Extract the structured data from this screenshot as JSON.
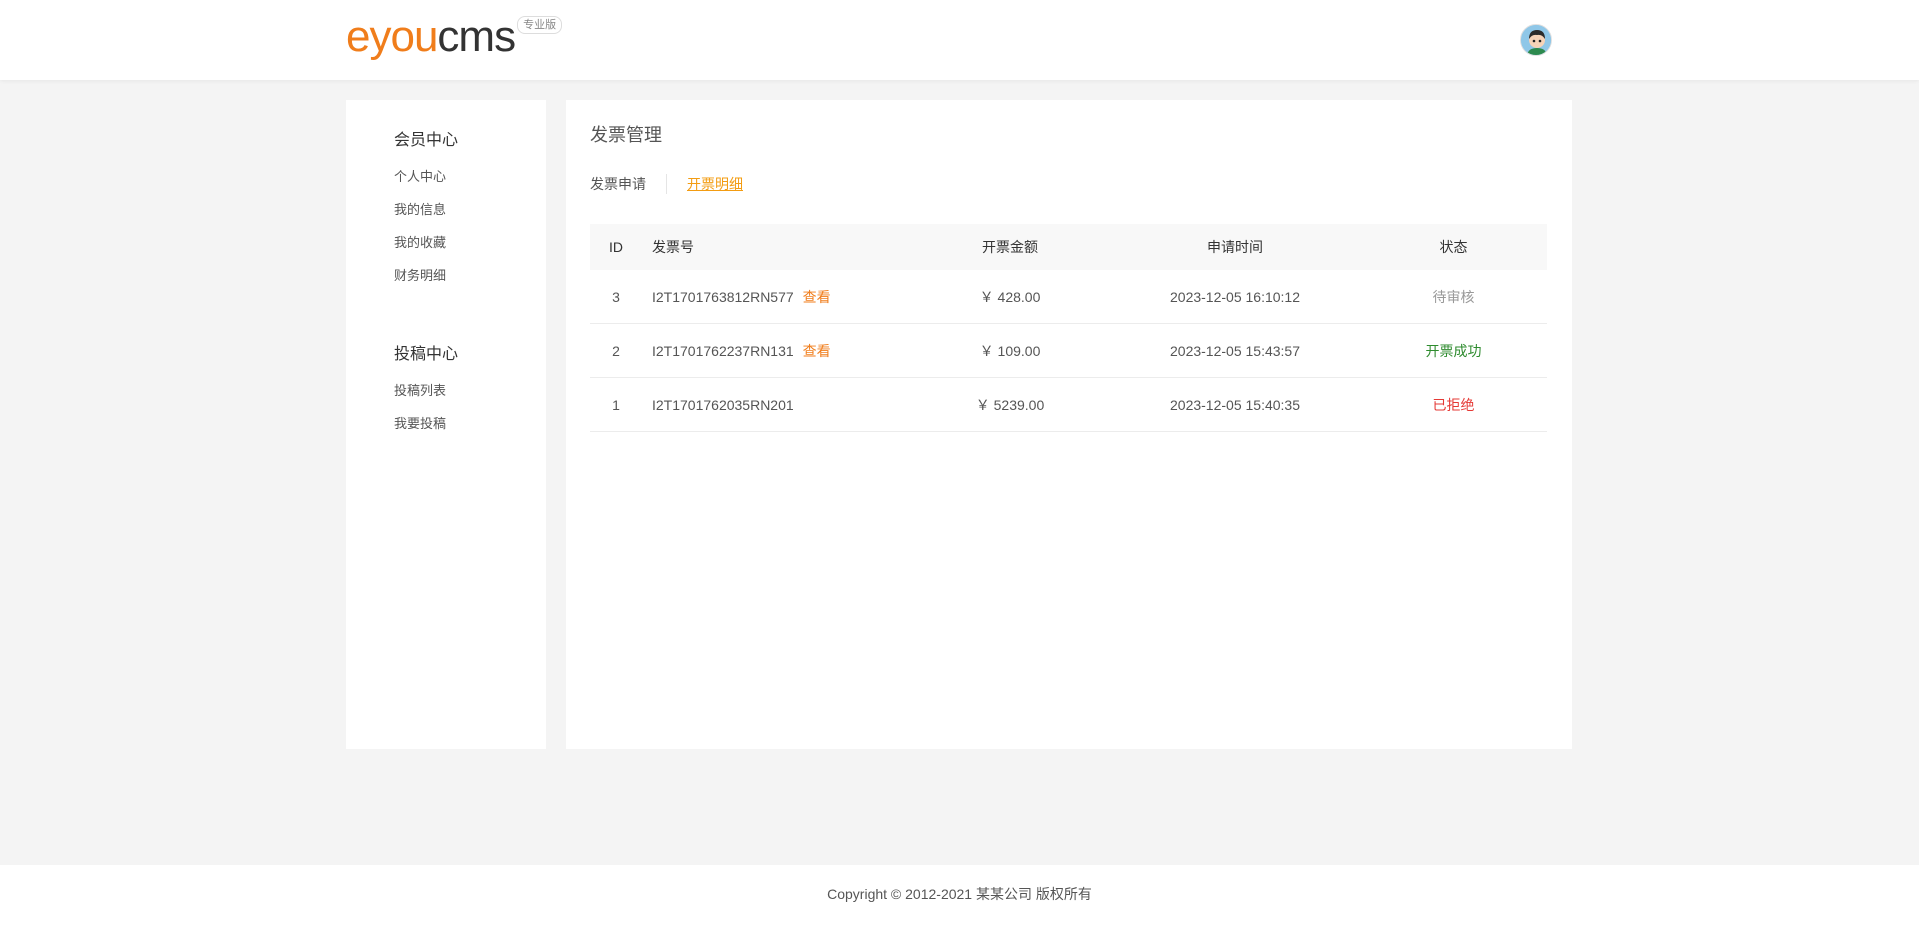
{
  "header": {
    "logo_part1": "eyou",
    "logo_part2": "cms",
    "logo_badge": "专业版",
    "brand_color": "#f07d1b"
  },
  "sidebar": {
    "groups": [
      {
        "title": "会员中心",
        "items": [
          {
            "label": "个人中心"
          },
          {
            "label": "我的信息"
          },
          {
            "label": "我的收藏"
          },
          {
            "label": "财务明细"
          }
        ]
      },
      {
        "title": "投稿中心",
        "items": [
          {
            "label": "投稿列表"
          },
          {
            "label": "我要投稿"
          }
        ]
      }
    ]
  },
  "main": {
    "title": "发票管理",
    "tabs": [
      {
        "label": "发票申请",
        "active": false
      },
      {
        "label": "开票明细",
        "active": true
      }
    ],
    "table": {
      "columns": [
        "ID",
        "发票号",
        "开票金额",
        "申请时间",
        "状态"
      ],
      "rows": [
        {
          "id": "3",
          "invoice_no": "I2T1701763812RN577",
          "view": "查看",
          "amount": "￥ 428.00",
          "time": "2023-12-05 16:10:12",
          "status": "待审核",
          "status_color": "#999999"
        },
        {
          "id": "2",
          "invoice_no": "I2T1701762237RN131",
          "view": "查看",
          "amount": "￥ 109.00",
          "time": "2023-12-05 15:43:57",
          "status": "开票成功",
          "status_color": "#2e8b2e"
        },
        {
          "id": "1",
          "invoice_no": "I2T1701762035RN201",
          "view": "",
          "amount": "￥ 5239.00",
          "time": "2023-12-05 15:40:35",
          "status": "已拒绝",
          "status_color": "#e53935"
        }
      ]
    }
  },
  "footer": {
    "copyright": "Copyright © 2012-2021 某某公司 版权所有"
  }
}
